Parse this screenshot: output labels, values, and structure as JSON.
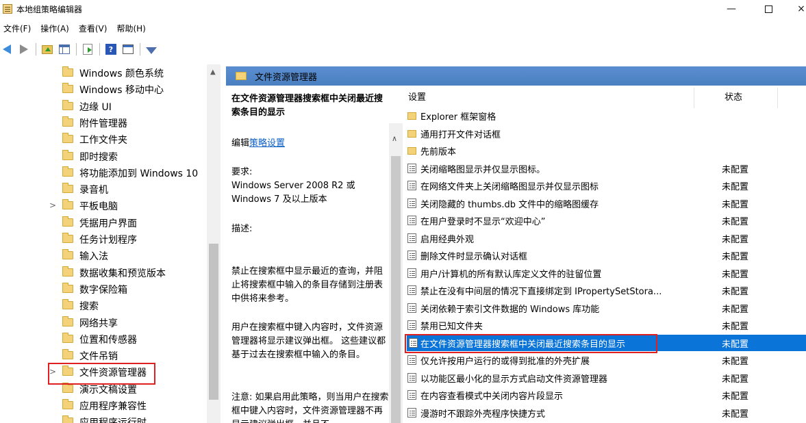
{
  "window": {
    "title": "本地组策略编辑器",
    "min": "—",
    "close": "×"
  },
  "menu": [
    "文件(F)",
    "操作(A)",
    "查看(V)",
    "帮助(H)"
  ],
  "toolbar": {
    "help_glyph": "?"
  },
  "tree": {
    "items": [
      {
        "label": "Windows 颜色系统",
        "expander": ""
      },
      {
        "label": "Windows 移动中心",
        "expander": ""
      },
      {
        "label": "边缘 UI",
        "expander": ""
      },
      {
        "label": "附件管理器",
        "expander": ""
      },
      {
        "label": "工作文件夹",
        "expander": ""
      },
      {
        "label": "即时搜索",
        "expander": ""
      },
      {
        "label": "将功能添加到 Windows 10",
        "expander": ""
      },
      {
        "label": "录音机",
        "expander": ""
      },
      {
        "label": "平板电脑",
        "expander": ">"
      },
      {
        "label": "凭据用户界面",
        "expander": ""
      },
      {
        "label": "任务计划程序",
        "expander": ""
      },
      {
        "label": "输入法",
        "expander": ""
      },
      {
        "label": "数据收集和预览版本",
        "expander": ""
      },
      {
        "label": "数字保险箱",
        "expander": ""
      },
      {
        "label": "搜索",
        "expander": ""
      },
      {
        "label": "网络共享",
        "expander": ""
      },
      {
        "label": "位置和传感器",
        "expander": ""
      },
      {
        "label": "文件吊销",
        "expander": ""
      },
      {
        "label": "文件资源管理器",
        "expander": ">"
      },
      {
        "label": "演示文稿设置",
        "expander": ""
      },
      {
        "label": "应用程序兼容性",
        "expander": ""
      },
      {
        "label": "应用程序运行时",
        "expander": ""
      }
    ]
  },
  "panel": {
    "header_title": "文件资源管理器",
    "desc": {
      "title": "在文件资源管理器搜索框中关闭最近搜索条目的显示",
      "edit_prefix": "编辑",
      "edit_link": "策略设置",
      "req_label": "要求:",
      "req_text": "Windows Server 2008 R2 或 Windows 7 及以上版本",
      "desc_label": "描述:",
      "para1": "禁止在搜索框中显示最近的查询，并阻止将搜索框中输入的条目存储到注册表中供将来参考。",
      "para2": "用户在搜索框中键入内容时，文件资源管理器将显示建议弹出框。 这些建议都基于过去在搜索框中输入的条目。",
      "para3": "注意: 如果启用此策略，则当用户在搜索框中键入内容时，文件资源管理器不再显示建议弹出框，并且不"
    },
    "columns": {
      "setting": "设置",
      "state": "状态"
    },
    "rows": [
      {
        "type": "folder",
        "name": "Explorer 框架窗格",
        "state": ""
      },
      {
        "type": "folder",
        "name": "通用打开文件对话框",
        "state": ""
      },
      {
        "type": "folder",
        "name": "先前版本",
        "state": ""
      },
      {
        "type": "setting",
        "name": "关闭缩略图显示并仅显示图标。",
        "state": "未配置"
      },
      {
        "type": "setting",
        "name": "在网络文件夹上关闭缩略图显示并仅显示图标",
        "state": "未配置"
      },
      {
        "type": "setting",
        "name": "关闭隐藏的 thumbs.db 文件中的缩略图缓存",
        "state": "未配置"
      },
      {
        "type": "setting",
        "name": "在用户登录时不显示“欢迎中心”",
        "state": "未配置"
      },
      {
        "type": "setting",
        "name": "启用经典外观",
        "state": "未配置"
      },
      {
        "type": "setting",
        "name": "删除文件时显示确认对话框",
        "state": "未配置"
      },
      {
        "type": "setting",
        "name": "用户/计算机的所有默认库定义文件的驻留位置",
        "state": "未配置"
      },
      {
        "type": "setting",
        "name": "禁止在没有中间层的情况下直接绑定到 IPropertySetStora...",
        "state": "未配置"
      },
      {
        "type": "setting",
        "name": "关闭依赖于索引文件数据的 Windows 库功能",
        "state": "未配置"
      },
      {
        "type": "setting",
        "name": "禁用已知文件夹",
        "state": "未配置"
      },
      {
        "type": "setting",
        "name": "在文件资源管理器搜索框中关闭最近搜索条目的显示",
        "state": "未配置",
        "selected": true
      },
      {
        "type": "setting",
        "name": "仅允许按用户运行的或得到批准的外壳扩展",
        "state": "未配置"
      },
      {
        "type": "setting",
        "name": "以功能区最小化的显示方式启动文件资源管理器",
        "state": "未配置"
      },
      {
        "type": "setting",
        "name": "在内容查看模式中关闭内容片段显示",
        "state": "未配置"
      },
      {
        "type": "setting",
        "name": "漫游时不跟踪外壳程序快捷方式",
        "state": "未配置"
      }
    ]
  },
  "colors": {
    "accent": "#0a74d8",
    "header": "#4f81bd",
    "highlight": "#e02020"
  }
}
